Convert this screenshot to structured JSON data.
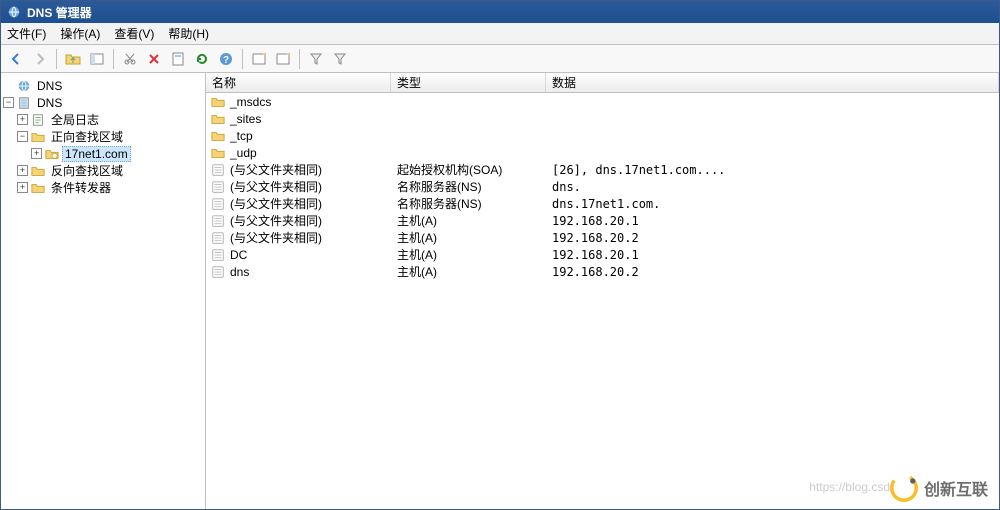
{
  "window": {
    "title": "DNS 管理器"
  },
  "menu": {
    "file": "文件(F)",
    "action": "操作(A)",
    "view": "查看(V)",
    "help": "帮助(H)"
  },
  "tree": {
    "root": "DNS",
    "server": "DNS",
    "global_log": "全局日志",
    "forward_zone": "正向查找区域",
    "zone_17net1": "17net1.com",
    "reverse_zone": "反向查找区域",
    "conditional": "条件转发器"
  },
  "columns": {
    "name": "名称",
    "type": "类型",
    "data": "数据"
  },
  "rows": [
    {
      "icon": "folder",
      "name": "_msdcs",
      "type": "",
      "data": ""
    },
    {
      "icon": "folder",
      "name": "_sites",
      "type": "",
      "data": ""
    },
    {
      "icon": "folder",
      "name": "_tcp",
      "type": "",
      "data": ""
    },
    {
      "icon": "folder",
      "name": "_udp",
      "type": "",
      "data": ""
    },
    {
      "icon": "record",
      "name": "(与父文件夹相同)",
      "type": "起始授权机构(SOA)",
      "data": "[26], dns.17net1.com...."
    },
    {
      "icon": "record",
      "name": "(与父文件夹相同)",
      "type": "名称服务器(NS)",
      "data": "dns."
    },
    {
      "icon": "record",
      "name": "(与父文件夹相同)",
      "type": "名称服务器(NS)",
      "data": "dns.17net1.com."
    },
    {
      "icon": "record",
      "name": "(与父文件夹相同)",
      "type": "主机(A)",
      "data": "192.168.20.1"
    },
    {
      "icon": "record",
      "name": "(与父文件夹相同)",
      "type": "主机(A)",
      "data": "192.168.20.2"
    },
    {
      "icon": "record",
      "name": "DC",
      "type": "主机(A)",
      "data": "192.168.20.1"
    },
    {
      "icon": "record",
      "name": "dns",
      "type": "主机(A)",
      "data": "192.168.20.2"
    }
  ],
  "watermark": {
    "text": "创新互联",
    "url": "https://blog.csd"
  }
}
